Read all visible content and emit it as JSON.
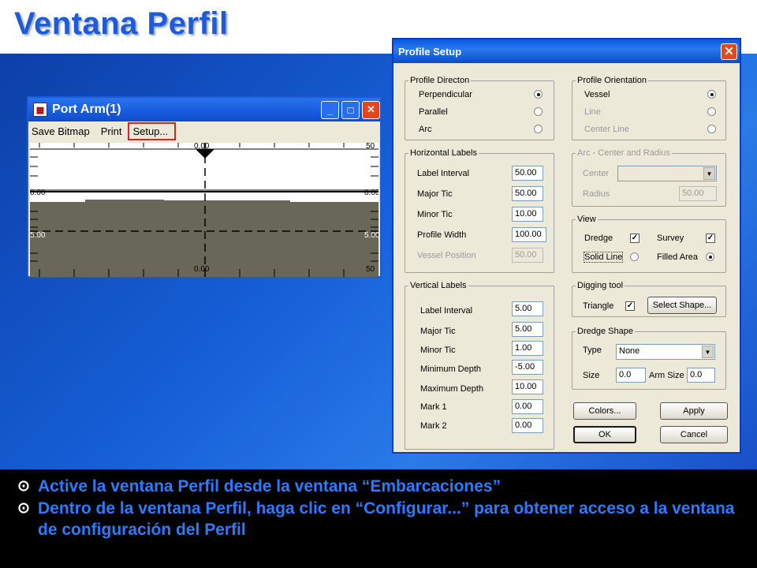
{
  "slide": {
    "title": "Ventana Perfil",
    "bullets": [
      "Active la ventana Perfil desde la ventana “Embarcaciones”",
      "Dentro de la ventana Perfil, haga clic en “Configurar...” para obtener acceso a la ventana de configuración del Perfil"
    ],
    "bullet_glyph": "⊙"
  },
  "port_window": {
    "title": "Port Arm(1)",
    "menu": [
      "Save Bitmap",
      "Print",
      "Setup..."
    ],
    "ticks": {
      "top_center": "0.00",
      "top_right": "50",
      "left_upper": "0.00",
      "left_lower": "5.00",
      "right_upper": "0.00",
      "right_lower": "5.00",
      "bottom_center": "0.00",
      "bottom_right": "50"
    }
  },
  "profile_setup": {
    "title": "Profile Setup",
    "profile_direction": {
      "legend": "Profile Directon",
      "options": [
        "Perpendicular",
        "Parallel",
        "Arc"
      ],
      "selected": "Perpendicular"
    },
    "profile_orientation": {
      "legend": "Profile Orientation",
      "options": [
        "Vessel",
        "Line",
        "Center Line"
      ],
      "selected": "Vessel"
    },
    "horizontal_labels": {
      "legend": "Horizontal Labels",
      "fields": [
        {
          "label": "Label Interval",
          "value": "50.00"
        },
        {
          "label": "Major Tic",
          "value": "50.00"
        },
        {
          "label": "Minor Tic",
          "value": "10.00"
        },
        {
          "label": "Profile Width",
          "value": "100.00"
        },
        {
          "label": "Vessel Position",
          "value": "50.00"
        }
      ]
    },
    "arc": {
      "legend": "Arc - Center and Radius",
      "center_label": "Center",
      "center_value": "",
      "radius_label": "Radius",
      "radius_value": "50.00"
    },
    "view": {
      "legend": "View",
      "dredge": "Dredge",
      "survey": "Survey",
      "solid_line": "Solid Line",
      "filled_area": "Filled Area"
    },
    "vertical_labels": {
      "legend": "Vertical Labels",
      "fields": [
        {
          "label": "Label Interval",
          "value": "5.00"
        },
        {
          "label": "Major Tic",
          "value": "5.00"
        },
        {
          "label": "Minor Tic",
          "value": "1.00"
        },
        {
          "label": "Minimum Depth",
          "value": "-5.00"
        },
        {
          "label": "Maximum Depth",
          "value": "10.00"
        },
        {
          "label": "Mark 1",
          "value": "0.00"
        },
        {
          "label": "Mark 2",
          "value": "0.00"
        }
      ]
    },
    "digging_tool": {
      "legend": "Digging tool",
      "triangle": "Triangle",
      "select_shape": "Select Shape..."
    },
    "dredge_shape": {
      "legend": "Dredge Shape",
      "type_label": "Type",
      "type_value": "None",
      "size_label": "Size",
      "size_value": "0.0",
      "arm_size_label": "Arm Size",
      "arm_size_value": "0.0"
    },
    "buttons": {
      "colors": "Colors...",
      "apply": "Apply",
      "ok": "OK",
      "cancel": "Cancel"
    }
  }
}
